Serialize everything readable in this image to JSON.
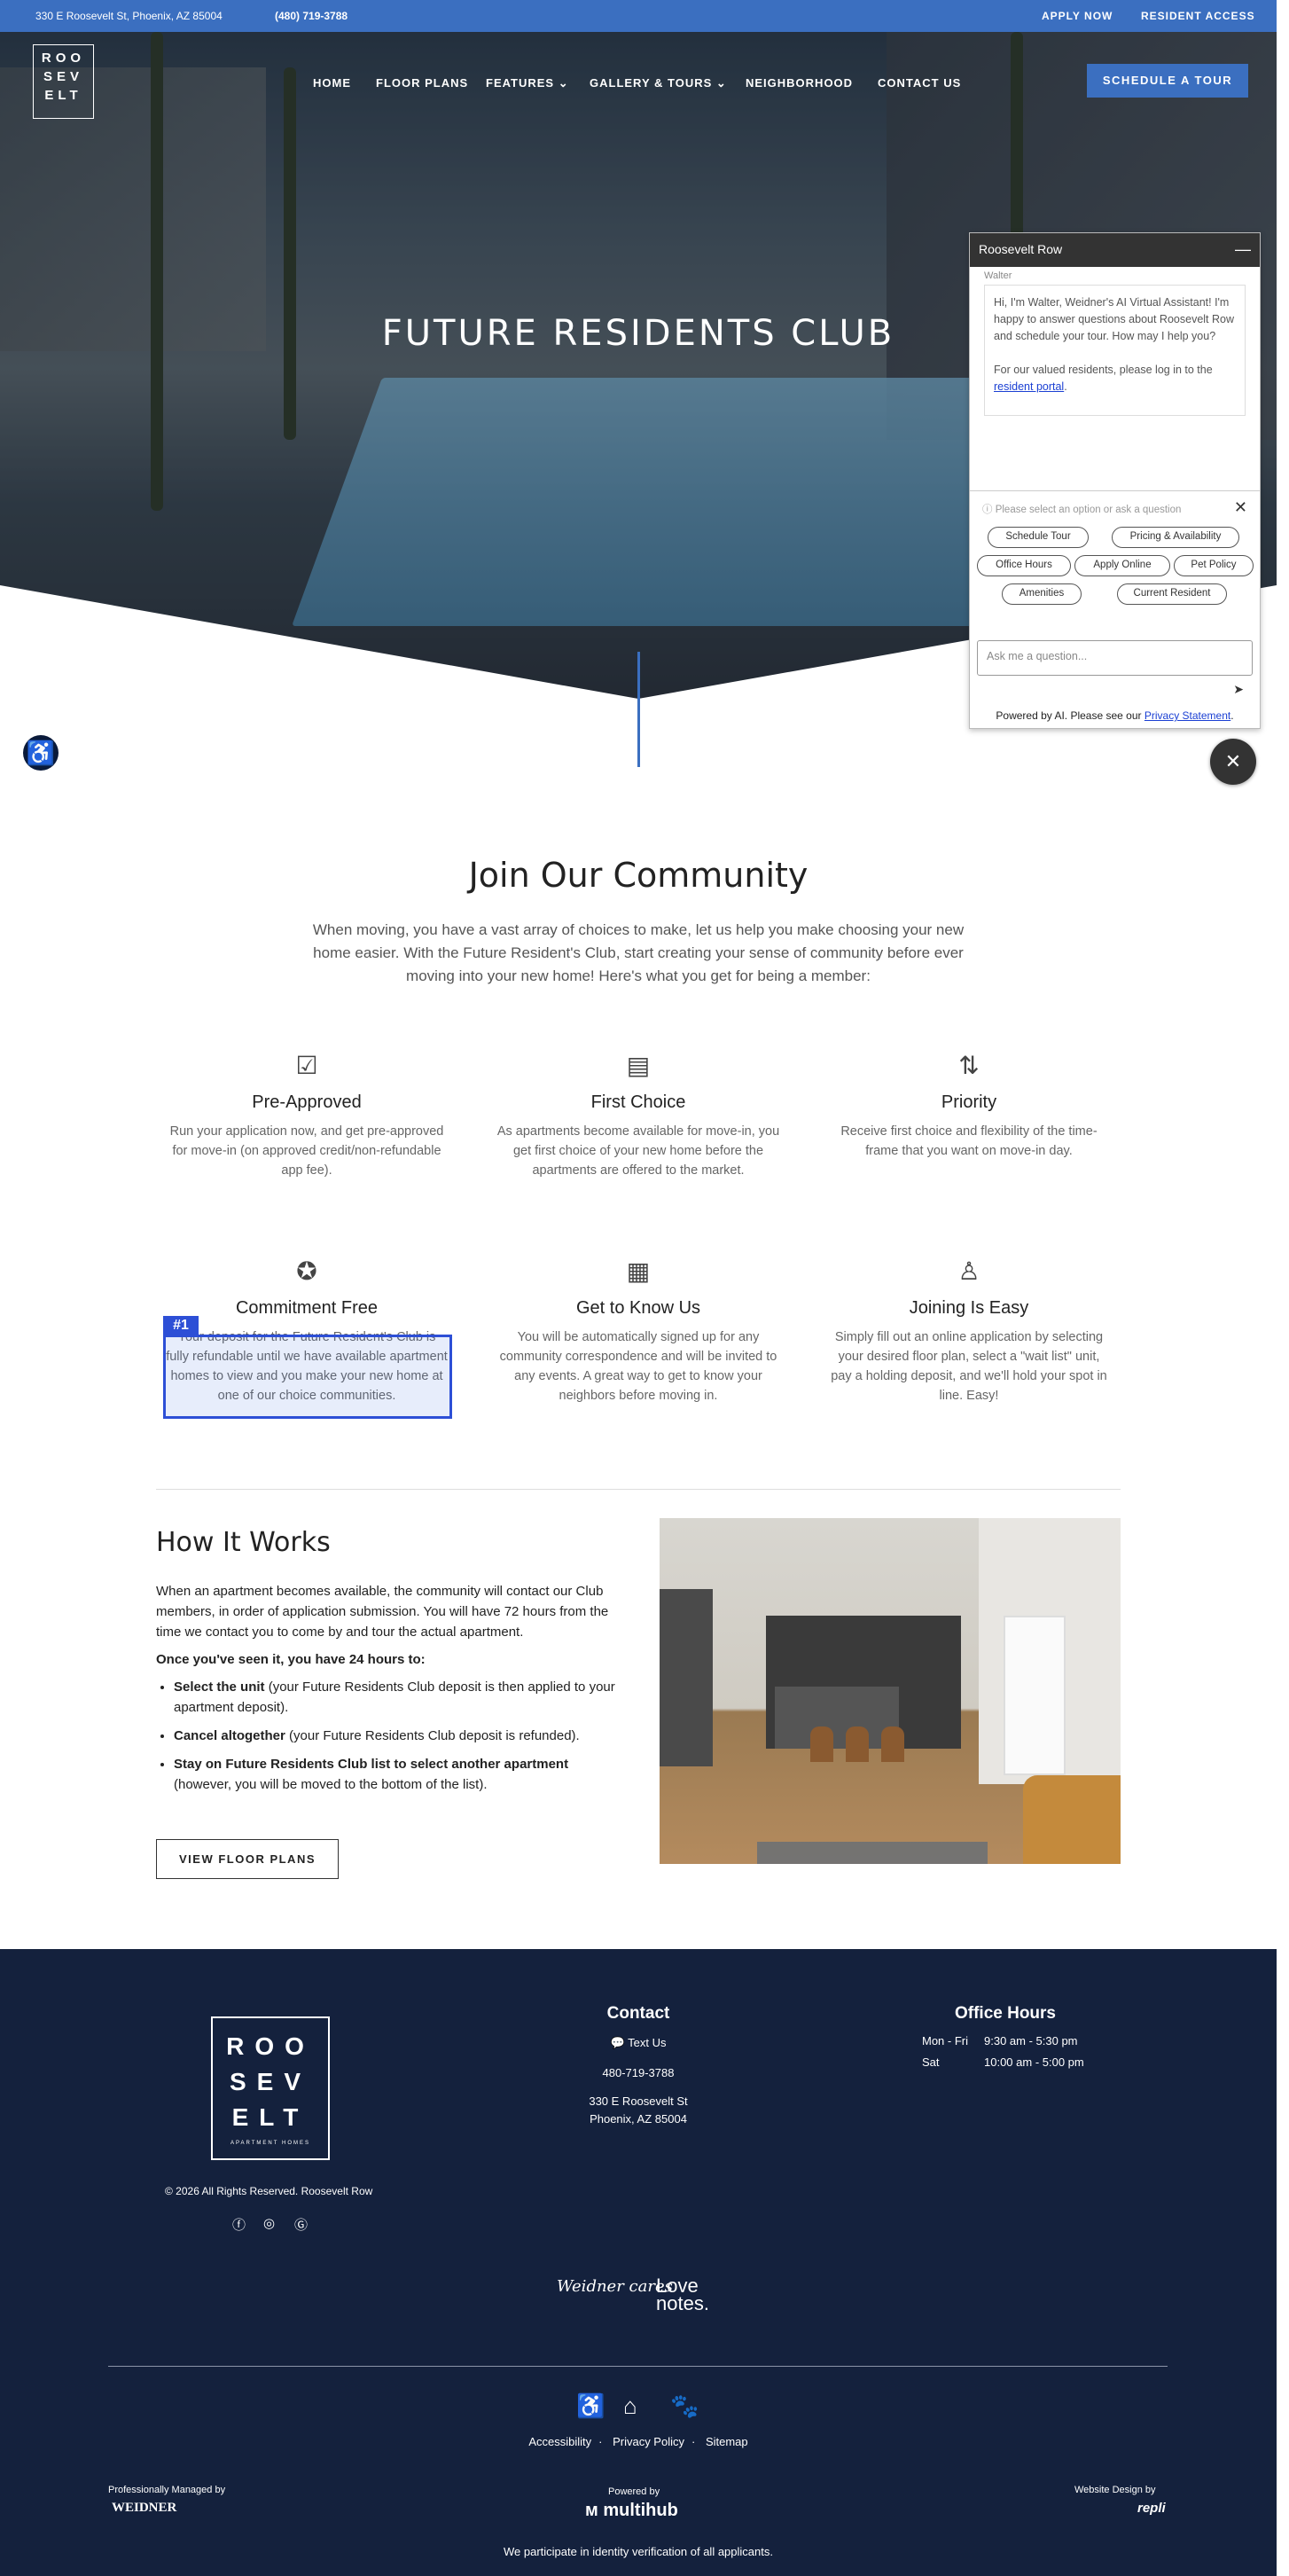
{
  "topbar": {
    "address": "330 E Roosevelt St, Phoenix, AZ 85004",
    "phone": "(480) 719-3788",
    "apply": "APPLY NOW",
    "resident": "RESIDENT ACCESS"
  },
  "logo": {
    "line1": "ROO",
    "line2": "SEV",
    "line3": "ELT"
  },
  "nav": {
    "home": "HOME",
    "floor_plans": "FLOOR PLANS",
    "features": "FEATURES",
    "gallery": "GALLERY & TOURS",
    "neighborhood": "NEIGHBORHOOD",
    "contact": "CONTACT US",
    "schedule": "SCHEDULE A TOUR"
  },
  "hero": {
    "title": "FUTURE RESIDENTS CLUB"
  },
  "chat": {
    "header": "Roosevelt Row",
    "agent": "Walter",
    "message1": "Hi, I'm Walter, Weidner's AI Virtual Assistant! I'm happy to answer questions about Roosevelt Row and schedule your tour. How may I help you?",
    "message2": "For our valued residents, please log in to the",
    "message_link": "resident portal",
    "prompt": "Please select an option or ask a question",
    "options": [
      "Schedule Tour",
      "Pricing & Availability",
      "Office Hours",
      "Apply Online",
      "Pet Policy",
      "Amenities",
      "Current Resident"
    ],
    "input_placeholder": "Ask me a question...",
    "footer_text": "Powered by AI. Please see our",
    "footer_link": "Privacy Statement"
  },
  "join": {
    "title": "Join Our Community",
    "intro": "When moving, you have a vast array of choices to make, let us help you make choosing your new home easier. With the Future Resident's Club, start creating your sense of community before ever moving into your new home! Here's what you get for being a member:",
    "features": [
      {
        "title": "Pre-Approved",
        "text": "Run your application now, and get pre-approved for move-in (on approved credit/non-refundable app fee)."
      },
      {
        "title": "First Choice",
        "text": "As apartments become available for move-in, you get first choice of your new home before the apartments are offered to the market."
      },
      {
        "title": "Priority",
        "text": "Receive first choice and flexibility of the time-frame that you want on move-in day."
      },
      {
        "title": "Commitment Free",
        "text": "Your deposit for the Future Resident's Club is fully refundable until we have available apartment homes to view and you make your new home at one of our choice communities."
      },
      {
        "title": "Get to Know Us",
        "text": "You will be automatically signed up for any community correspondence and will be invited to any events. A great way to get to know your neighbors before moving in."
      },
      {
        "title": "Joining Is Easy",
        "text": "Simply fill out an online application by selecting your desired floor plan, select a \"wait list\" unit, pay a holding deposit, and we'll hold your spot in line. Easy!"
      }
    ],
    "badge": "#1"
  },
  "how": {
    "title": "How It Works",
    "p1": "When an apartment becomes available, the community will contact our Club members, in order of application submission. You will have 72 hours from the time we contact you to come by and tour the actual apartment.",
    "p2": "Once you've seen it, you have 24 hours to:",
    "items": [
      {
        "bold": "Select the unit",
        "rest": " (your Future Residents Club deposit is then applied to your apartment deposit)."
      },
      {
        "bold": "Cancel altogether",
        "rest": " (your Future Residents Club deposit is refunded)."
      },
      {
        "bold": "Stay on Future Residents Club list to select another apartment",
        "rest": " (however, you will be moved to the bottom of the list)."
      }
    ],
    "button": "VIEW FLOOR PLANS"
  },
  "footer": {
    "logo_lines": [
      "ROO",
      "SEV",
      "ELT"
    ],
    "logo_sub": "APARTMENT HOMES",
    "copyright": "© 2026 All Rights Reserved. Roosevelt Row",
    "contact_title": "Contact",
    "text_us": "Text Us",
    "phone": "480-719-3788",
    "addr1": "330 E Roosevelt St",
    "addr2": "Phoenix, AZ 85004",
    "hours_title": "Office Hours",
    "hours": [
      {
        "day": "Mon - Fri",
        "time": "9:30 am - 5:30 pm"
      },
      {
        "day": "Sat",
        "time": "10:00 am - 5:00 pm"
      }
    ],
    "brand1": "Weidner cares",
    "brand2a": "Love",
    "brand2b": "notes.",
    "links": [
      "Accessibility",
      "Privacy Policy",
      "Sitemap"
    ],
    "managed": "Professionally Managed by",
    "managed_brand": "WEIDNER",
    "powered": "Powered by",
    "powered_brand": "multihub",
    "design": "Website Design by",
    "design_brand": "repli",
    "note": "We participate in identity verification of all applicants."
  }
}
